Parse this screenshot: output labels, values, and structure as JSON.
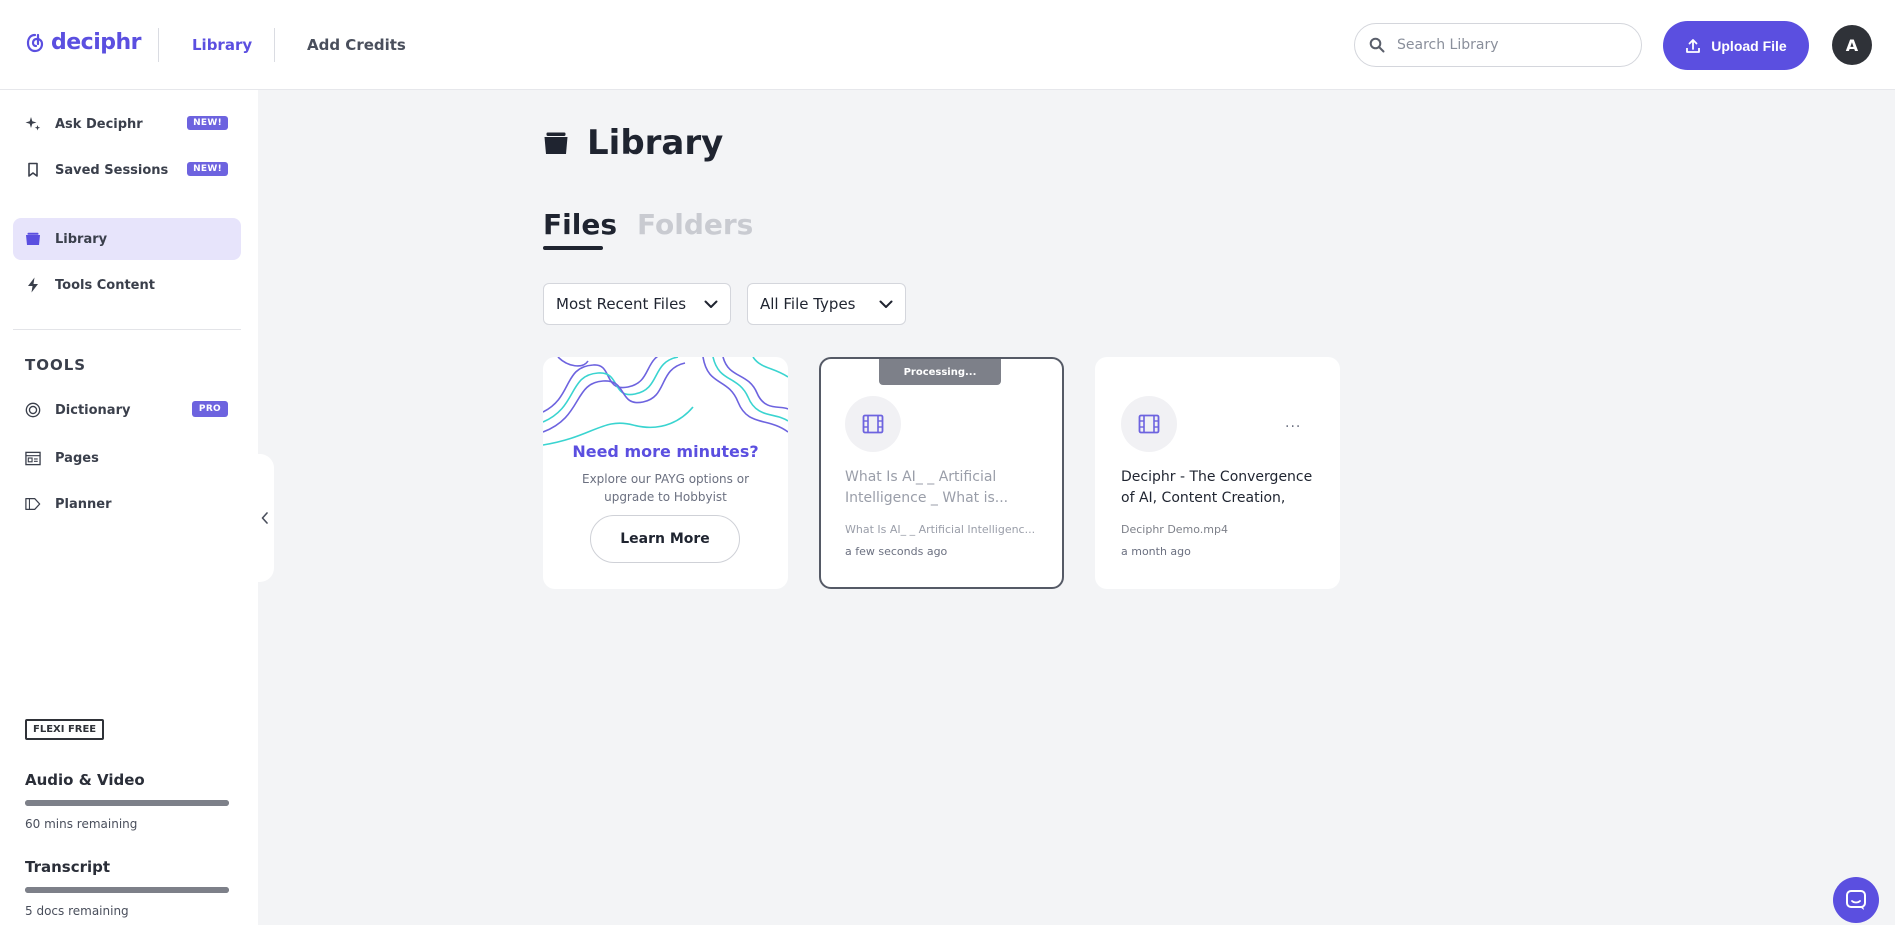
{
  "header": {
    "logo_text": "deciphr",
    "nav": {
      "library": "Library",
      "add_credits": "Add Credits"
    },
    "search": {
      "placeholder": "Search Library",
      "value": ""
    },
    "upload_label": "Upload File",
    "avatar_initial": "A"
  },
  "sidebar": {
    "items": [
      {
        "label": "Ask Deciphr",
        "badge": "NEW!",
        "icon": "sparkle-icon"
      },
      {
        "label": "Saved Sessions",
        "badge": "NEW!",
        "icon": "bookmark-icon"
      },
      {
        "label": "Library",
        "badge": "",
        "icon": "folder-icon",
        "active": true
      },
      {
        "label": "Tools Content",
        "badge": "",
        "icon": "lightning-icon"
      }
    ],
    "tools_heading": "TOOLS",
    "tools": [
      {
        "label": "Dictionary",
        "badge": "PRO",
        "icon": "target-icon"
      },
      {
        "label": "Pages",
        "badge": "",
        "icon": "pages-icon"
      },
      {
        "label": "Planner",
        "badge": "",
        "icon": "planner-icon"
      }
    ],
    "plan": "FLEXI FREE",
    "usage": [
      {
        "title": "Audio & Video",
        "remaining": "60 mins remaining",
        "fill": 1.0
      },
      {
        "title": "Transcript",
        "remaining": "5 docs remaining",
        "fill": 1.0
      }
    ]
  },
  "main": {
    "title": "Library",
    "tabs": {
      "files": "Files",
      "folders": "Folders"
    },
    "filters": {
      "sort": "Most Recent Files",
      "type": "All File Types"
    },
    "promo": {
      "title": "Need more minutes?",
      "text": "Explore our PAYG options or upgrade to Hobbyist",
      "button": "Learn More"
    },
    "files": [
      {
        "status": "Processing...",
        "title": "What Is AI_ _ Artificial Intelligence _ What is...",
        "filename": "What Is AI_ _ Artificial Intelligenc...",
        "time": "a few seconds ago"
      },
      {
        "status": "",
        "title": "Deciphr - The Convergence of AI, Content Creation, and...",
        "filename": "Deciphr Demo.mp4",
        "time": "a month ago",
        "more": "..."
      }
    ]
  },
  "colors": {
    "accent": "#5b4fe0",
    "active_bg": "#e7e4fb"
  }
}
